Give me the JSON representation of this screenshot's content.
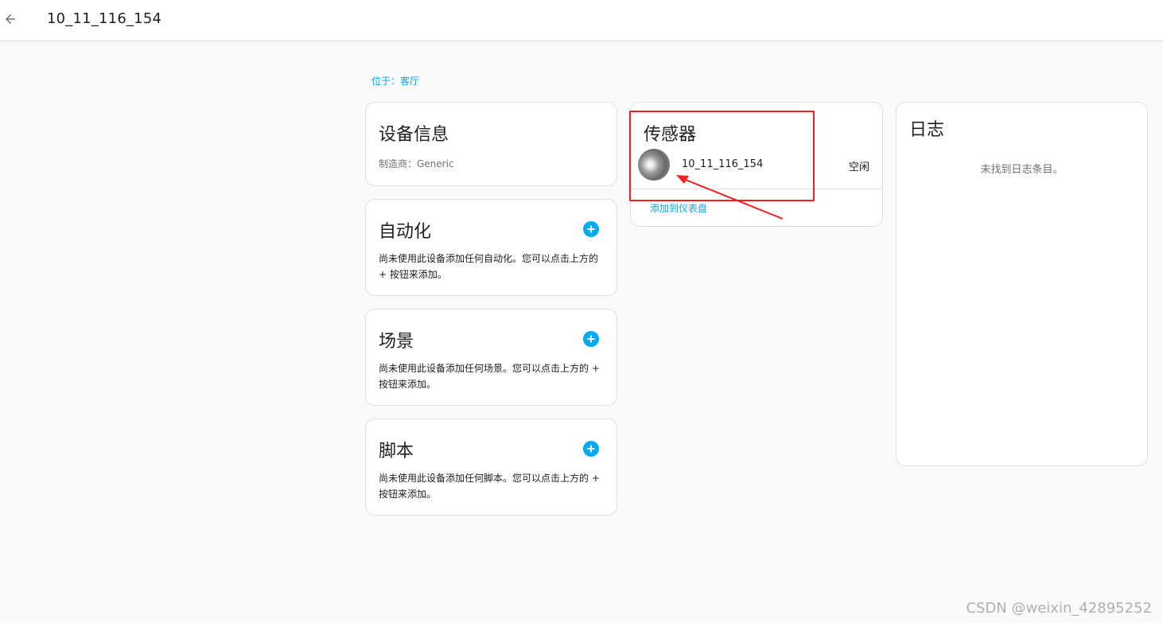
{
  "header": {
    "title": "10_11_116_154"
  },
  "location_label": "位于：客厅",
  "device_info": {
    "title": "设备信息",
    "manufacturer": "制造商：Generic"
  },
  "automation": {
    "title": "自动化",
    "description": "尚未使用此设备添加任何自动化。您可以点击上方的 + 按钮来添加。"
  },
  "scene": {
    "title": "场景",
    "description": "尚未使用此设备添加任何场景。您可以点击上方的 + 按钮来添加。"
  },
  "script": {
    "title": "脚本",
    "description": "尚未使用此设备添加任何脚本。您可以点击上方的 + 按钮来添加。"
  },
  "sensors": {
    "title": "传感器",
    "entity_name": "10_11_116_154",
    "entity_state": "空闲",
    "add_to_dashboard": "添加到仪表盘"
  },
  "logbook": {
    "title": "日志",
    "empty_text": "未找到日志条目。"
  },
  "watermark": "CSDN @weixin_42895252",
  "colors": {
    "accent": "#03a9f4",
    "annotation": "#f02020"
  },
  "icons": [
    "arrow-left-icon",
    "plus-circle-icon",
    "sensor-avatar"
  ]
}
